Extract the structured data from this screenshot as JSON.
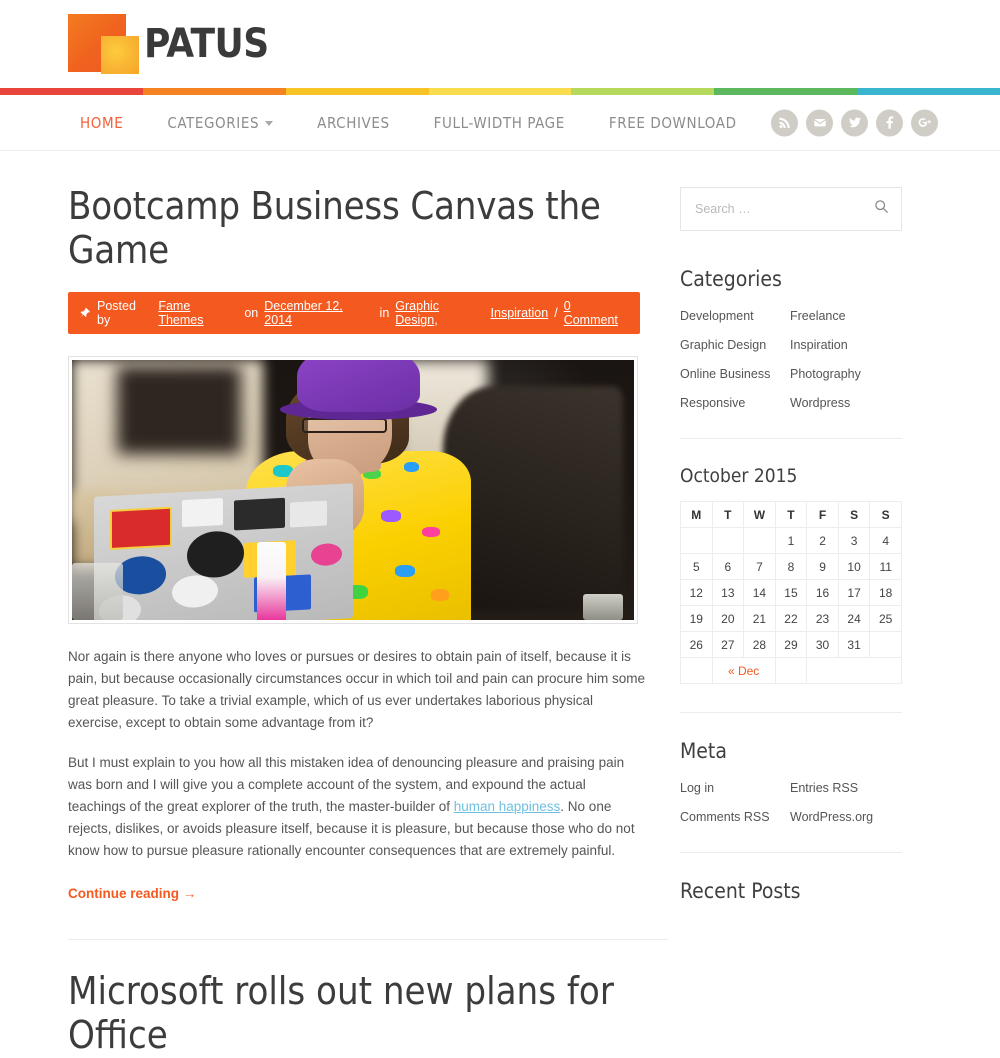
{
  "site": {
    "logo_text": "PATUS",
    "rainbow_colors": [
      "#e8453c",
      "#f58220",
      "#f7c325",
      "#f9dd4e",
      "#b5d95b",
      "#5cb85c",
      "#3ab5cf"
    ]
  },
  "nav": {
    "items": [
      {
        "label": "HOME",
        "active": true,
        "has_caret": false
      },
      {
        "label": "CATEGORIES",
        "active": false,
        "has_caret": true
      },
      {
        "label": "ARCHIVES",
        "active": false,
        "has_caret": false
      },
      {
        "label": "FULL-WIDTH PAGE",
        "active": false,
        "has_caret": false
      },
      {
        "label": "FREE DOWNLOAD",
        "active": false,
        "has_caret": false
      }
    ],
    "social": [
      {
        "name": "rss-icon",
        "title": "RSS"
      },
      {
        "name": "email-icon",
        "title": "Email"
      },
      {
        "name": "twitter-icon",
        "title": "Twitter"
      },
      {
        "name": "facebook-icon",
        "title": "Facebook"
      },
      {
        "name": "google-plus-icon",
        "title": "Google Plus"
      }
    ]
  },
  "post": {
    "title": "Bootcamp Business Canvas the Game",
    "meta": {
      "posted_by_label": "Posted by",
      "author": "Fame Themes",
      "on_label": "on",
      "date": "December 12, 2014",
      "in_label": "in",
      "category_1": "Graphic Design",
      "comma": ",",
      "category_2": "Inspiration",
      "slash": "/",
      "comments": "0 Comment"
    },
    "paragraph_1": "Nor again is there anyone who loves or pursues or desires to obtain pain of itself, because it is pain, but because occasionally circumstances occur in which toil and pain can procure him some great pleasure. To take a trivial example, which of us ever undertakes laborious physical exercise, except to obtain some advantage from it?",
    "paragraph_2_a": "But I must explain to you how all this mistaken idea of denouncing pleasure and praising pain was born and I will give you a complete account of the system, and expound the actual teachings of the great explorer of the truth, the master-builder of ",
    "paragraph_2_link": "human happiness",
    "paragraph_2_b": ". No one rejects, dislikes, or avoids pleasure itself, because it is pleasure, but because those who do not know how to pursue pleasure rationally encounter consequences that are extremely painful.",
    "continue_reading": "Continue reading →"
  },
  "post_2": {
    "title": "Microsoft rolls out new plans for Office"
  },
  "sidebar": {
    "search": {
      "placeholder": "Search …",
      "value": "",
      "icon": "search-icon"
    },
    "categories": {
      "title": "Categories",
      "items": [
        "Development",
        "Freelance",
        "Graphic Design",
        "Inspiration",
        "Online Business",
        "Photography",
        "Responsive",
        "Wordpress"
      ]
    },
    "calendar": {
      "title": "October 2015",
      "weekdays": [
        "M",
        "T",
        "W",
        "T",
        "F",
        "S",
        "S"
      ],
      "weeks": [
        [
          "",
          "",
          "",
          "1",
          "2",
          "3",
          "4"
        ],
        [
          "5",
          "6",
          "7",
          "8",
          "9",
          "10",
          "11"
        ],
        [
          "12",
          "13",
          "14",
          "15",
          "16",
          "17",
          "18"
        ],
        [
          "19",
          "20",
          "21",
          "22",
          "23",
          "24",
          "25"
        ],
        [
          "26",
          "27",
          "28",
          "29",
          "30",
          "31",
          ""
        ]
      ],
      "prev_label": "« Dec"
    },
    "meta": {
      "title": "Meta",
      "items": [
        "Log in",
        "Entries RSS",
        "Comments RSS",
        "WordPress.org"
      ]
    },
    "recent_posts": {
      "title": "Recent Posts"
    }
  },
  "colors": {
    "accent": "#f4591f",
    "nav_active": "#f4603a",
    "link_blue": "#6fc0e0",
    "text": "#555555"
  }
}
